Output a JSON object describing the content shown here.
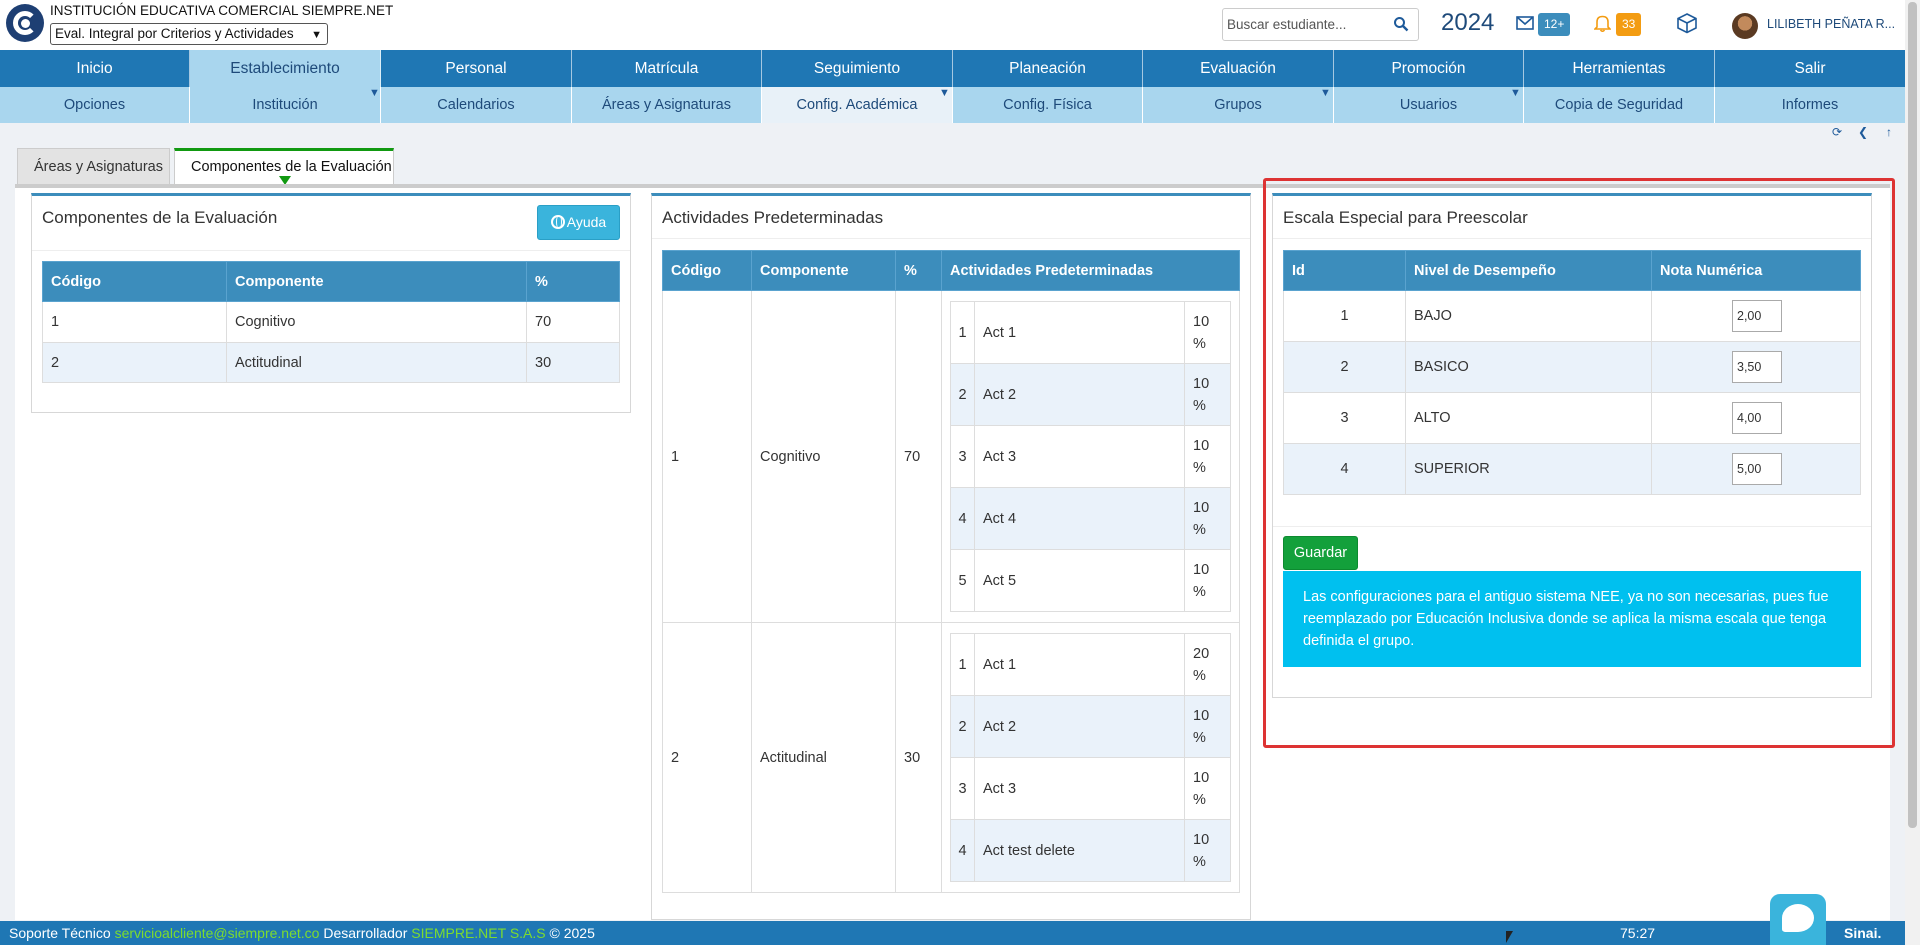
{
  "header": {
    "institution": "INSTITUCIÓN EDUCATIVA COMERCIAL SIEMPRE.NET",
    "mode_select": "Eval. Integral por Criterios y Actividades",
    "search_placeholder": "Buscar estudiante...",
    "year": "2024",
    "messages_badge": "12+",
    "notifications_badge": "33",
    "user_name": "LILIBETH PEÑATA R..."
  },
  "nav": [
    "Inicio",
    "Establecimiento",
    "Personal",
    "Matrícula",
    "Seguimiento",
    "Planeación",
    "Evaluación",
    "Promoción",
    "Herramientas",
    "Salir"
  ],
  "subnav": [
    "Opciones",
    "Institución",
    "Calendarios",
    "Áreas y Asignaturas",
    "Config. Académica",
    "Config. Física",
    "Grupos",
    "Usuarios",
    "Copia de Seguridad",
    "Informes"
  ],
  "tabs": [
    "Áreas y Asignaturas",
    "Componentes de la Evaluación"
  ],
  "components_panel": {
    "title": "Componentes de la Evaluación",
    "help_button": "Ayuda",
    "headers": [
      "Código",
      "Componente",
      "%"
    ],
    "rows": [
      [
        "1",
        "Cognitivo",
        "70"
      ],
      [
        "2",
        "Actitudinal",
        "30"
      ]
    ]
  },
  "activities_panel": {
    "title": "Actividades Predeterminadas",
    "headers": [
      "Código",
      "Componente",
      "%",
      "Actividades Predeterminadas"
    ],
    "groups": [
      {
        "code": "1",
        "component": "Cognitivo",
        "pct": "70",
        "acts": [
          [
            "1",
            "Act 1",
            "10 %"
          ],
          [
            "2",
            "Act 2",
            "10 %"
          ],
          [
            "3",
            "Act 3",
            "10 %"
          ],
          [
            "4",
            "Act 4",
            "10 %"
          ],
          [
            "5",
            "Act 5",
            "10 %"
          ]
        ]
      },
      {
        "code": "2",
        "component": "Actitudinal",
        "pct": "30",
        "acts": [
          [
            "1",
            "Act 1",
            "20 %"
          ],
          [
            "2",
            "Act 2",
            "10 %"
          ],
          [
            "3",
            "Act 3",
            "10 %"
          ],
          [
            "4",
            "Act test delete",
            "10 %"
          ]
        ]
      }
    ]
  },
  "preschool_panel": {
    "title": "Escala Especial para Preescolar",
    "headers": [
      "Id",
      "Nivel de Desempeño",
      "Nota Numérica"
    ],
    "rows": [
      [
        "1",
        "BAJO",
        "2,00"
      ],
      [
        "2",
        "BASICO",
        "3,50"
      ],
      [
        "3",
        "ALTO",
        "4,00"
      ],
      [
        "4",
        "SUPERIOR",
        "5,00"
      ]
    ],
    "save_button": "Guardar",
    "info": "Las configuraciones para el antiguo sistema NEE, ya no son necesarias, pues fue reemplazado por Educación Inclusiva donde se aplica la misma escala que tenga definida el grupo."
  },
  "footer": {
    "support_label": "Soporte Técnico",
    "support_email": "servicioalcliente@siempre.net.co",
    "dev_label": "Desarrollador",
    "dev_name": "SIEMPRE.NET S.A.S",
    "copyright": "© 2025",
    "timer": "75:27",
    "brand": "Sinai."
  },
  "colors": {
    "primary": "#1f77b4",
    "sub": "#a9d6ee",
    "table_header": "#3c8dbc",
    "success": "#13a03b",
    "info": "#00c0ef",
    "highlight": "#dd3333"
  }
}
